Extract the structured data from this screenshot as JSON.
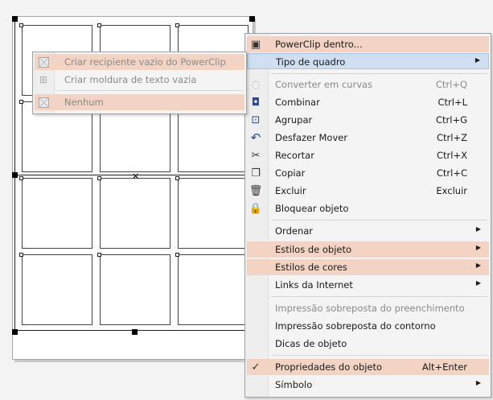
{
  "submenu": {
    "items": [
      {
        "label": "Criar recipiente vazio do PowerClip",
        "icon": "empty-powerclip-icon",
        "disabled": true
      },
      {
        "label": "Criar moldura de texto vazia",
        "icon": "text-frame-icon",
        "disabled": true
      },
      {
        "label": "Nenhum",
        "icon": "none-frame-icon",
        "disabled": true
      }
    ]
  },
  "menu": {
    "powerclip": {
      "label": "PowerClip dentro...",
      "icon": "powerclip-icon"
    },
    "frame_type": {
      "label": "Tipo de quadro"
    },
    "convert_curves": {
      "label": "Converter em curvas",
      "shortcut": "Ctrl+Q",
      "icon": "convert-curves-icon"
    },
    "combine": {
      "label": "Combinar",
      "shortcut": "Ctrl+L",
      "icon": "combine-icon"
    },
    "group": {
      "label": "Agrupar",
      "shortcut": "Ctrl+G",
      "icon": "group-icon"
    },
    "undo_move": {
      "label": "Desfazer Mover",
      "shortcut": "Ctrl+Z",
      "icon": "undo-icon"
    },
    "cut": {
      "label": "Recortar",
      "shortcut": "Ctrl+X",
      "icon": "scissors-icon"
    },
    "copy": {
      "label": "Copiar",
      "shortcut": "Ctrl+C",
      "icon": "copy-icon"
    },
    "delete": {
      "label": "Excluir",
      "shortcut": "Excluir",
      "icon": "trash-icon"
    },
    "lock": {
      "label": "Bloquear objeto",
      "icon": "lock-icon"
    },
    "order": {
      "label": "Ordenar"
    },
    "object_styles": {
      "label": "Estilos de objeto"
    },
    "color_styles": {
      "label": "Estilos de cores"
    },
    "internet_links": {
      "label": "Links da Internet"
    },
    "overprint_fill": {
      "label": "Impressão sobreposta do preenchimento"
    },
    "overprint_outline": {
      "label": "Impressão sobreposta do contorno"
    },
    "object_hints": {
      "label": "Dicas de objeto"
    },
    "object_properties": {
      "label": "Propriedades do objeto",
      "shortcut": "Alt+Enter",
      "icon": "checkmark-icon"
    },
    "symbol": {
      "label": "Símbolo"
    }
  },
  "colors": {
    "hover_orange": "#f2d3c4",
    "selected_blue": "#cfdff2",
    "disabled_text": "#8a8a8a"
  }
}
